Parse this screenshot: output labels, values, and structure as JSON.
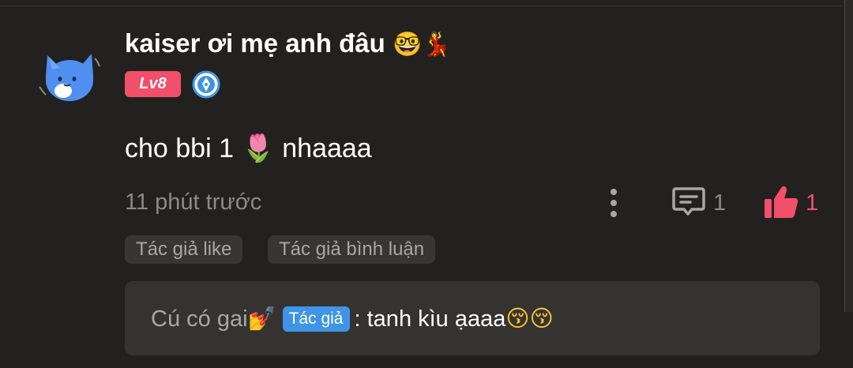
{
  "comment": {
    "username": "kaiser ơi mẹ anh đâu",
    "username_emoji": "🤓💃",
    "level": "Lv8",
    "text": "cho bbi 1",
    "text_emoji": "🌷",
    "text_after": "nhaaaa",
    "timestamp": "11 phút trước",
    "reply_count": "1",
    "like_count": "1",
    "liked": true
  },
  "tags": {
    "author_liked": "Tác giả like",
    "author_replied": "Tác giả bình luận"
  },
  "reply": {
    "author": "Cú có gai",
    "author_emoji": "💅",
    "author_badge": "Tác giả",
    "separator": ":",
    "text": "tanh kìu ạaaa",
    "text_emoji": "😚😚"
  },
  "icons": {
    "avatar": "blue-cat-avatar-icon",
    "verified": "pen-nib-badge-icon",
    "more": "vertical-dots-icon",
    "reply": "comment-bubble-icon",
    "like": "thumbs-up-icon"
  },
  "colors": {
    "background": "#232120",
    "accent_pink": "#f24f6a",
    "author_badge": "#3f94e6",
    "muted_text": "#8c8986",
    "reply_box": "#353331"
  }
}
